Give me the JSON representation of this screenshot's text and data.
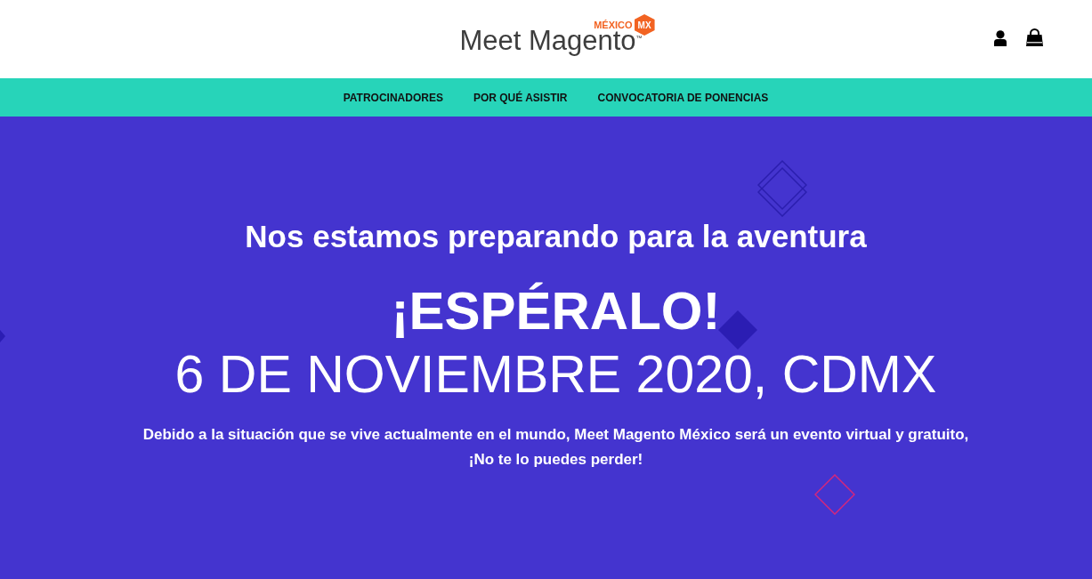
{
  "header": {
    "logo": {
      "name": "Meet Magento",
      "trademark": "™",
      "region": "MÉXICO",
      "badge": "MX"
    }
  },
  "nav": {
    "items": [
      "PATROCINADORES",
      "POR QUÉ ASISTIR",
      "CONVOCATORIA DE PONENCIAS"
    ]
  },
  "hero": {
    "subtitle": "Nos estamos preparando para la aventura",
    "title": "¡ESPÉRALO!",
    "date": "6 DE NOVIEMBRE 2020, CDMX",
    "description": "Debido a la situación que se vive actualmente en el mundo, Meet Magento México será un evento virtual y gratuito,\n¡No te lo puedes perder!"
  }
}
